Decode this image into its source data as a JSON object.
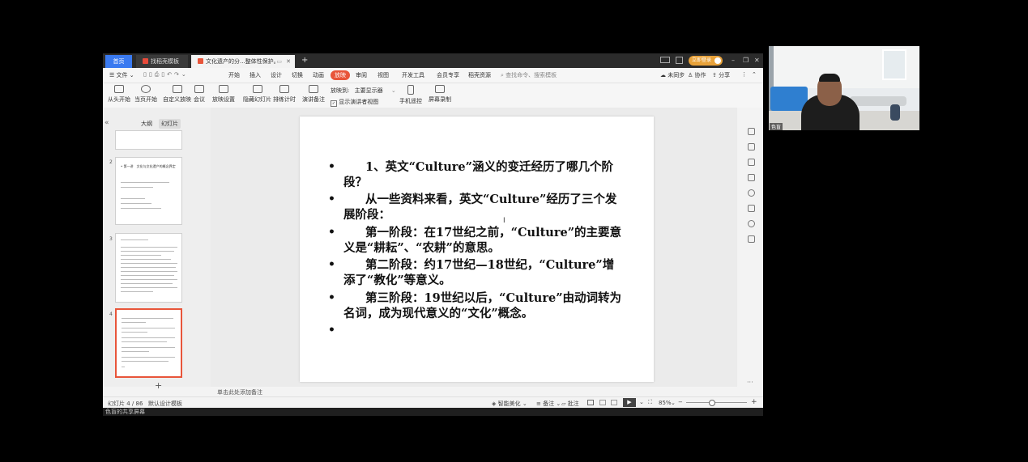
{
  "tabs": {
    "home": "首页",
    "template": "找稻壳模板",
    "document": "文化遗产的分...整体性保护。"
  },
  "titlebar": {
    "login_label": "立即登录"
  },
  "menu": {
    "file": "文件",
    "items": [
      "开始",
      "插入",
      "设计",
      "切换",
      "动画",
      "放映",
      "审阅",
      "视图",
      "开发工具",
      "会员专享",
      "稻壳资源"
    ],
    "active_index": 5,
    "search_placeholder": "查找命令、搜索模板",
    "sync": "未同步",
    "collab": "协作",
    "share": "分享"
  },
  "toolbar": {
    "from_start": "从头开始",
    "from_current": "当页开始",
    "custom": "自定义放映",
    "meeting": "会议",
    "setup": "放映设置",
    "hide": "隐藏幻灯片",
    "rehearse": "排练计时",
    "notes": "演讲备注",
    "show_on_label": "放映到:",
    "show_on_value": "主要显示器",
    "presenter_view": "显示演讲者视图",
    "phone_remote": "手机遥控",
    "screen_record": "屏幕录制"
  },
  "left_panel": {
    "outline_tab": "大纲",
    "slides_tab": "幻灯片",
    "slide_numbers": [
      "2",
      "3",
      "4"
    ],
    "thumb2_text": "• 第一讲　文化与文化遗产的概念界定"
  },
  "slide": {
    "bullets": [
      "1、英文“Culture”涵义的变迁经历了哪几个阶段？",
      "从一些资料来看，英文“Culture”经历了三个发展阶段：",
      "第一阶段：在17世纪之前，“Culture”的主要意义是“耕耘”、“农耕”的意思。",
      "第二阶段：约17世纪—18世纪，“Culture”增添了“教化”等意义。",
      "第三阶段：19世纪以后，“Culture”由动词转为名词，成为现代意义的“文化”概念。",
      ""
    ],
    "bullet_symbol": "•"
  },
  "notes_placeholder": "单击此处添加备注",
  "status": {
    "slide_counter": "幻灯片 4 / 86",
    "theme": "默认设计模板",
    "smart_beautify": "智能美化",
    "notes": "备注",
    "comments": "批注",
    "zoom": "85%"
  },
  "share_label": "色盲的共享屏幕",
  "video": {
    "participant_name": "色盲"
  },
  "colors": {
    "accent_orange": "#e8553a",
    "home_tab_blue": "#3a7af0",
    "selected_thumb_border": "#e8553a"
  }
}
